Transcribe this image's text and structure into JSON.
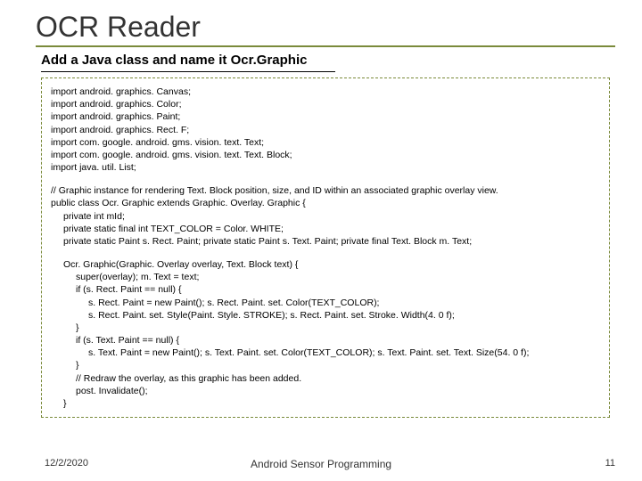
{
  "title": "OCR Reader",
  "subtitle": "Add a Java class and name it Ocr.Graphic",
  "imports": [
    "import android. graphics. Canvas;",
    "import android. graphics. Color;",
    "import android. graphics. Paint;",
    "import android. graphics. Rect. F;",
    "import com. google. android. gms. vision. text. Text;",
    "import com. google. android. gms. vision. text. Text. Block;",
    "import java. util. List;"
  ],
  "comment": "// Graphic instance for rendering Text. Block position, size, and ID within an associated graphic overlay view.",
  "classdecl": "public class Ocr. Graphic extends Graphic. Overlay. Graphic {",
  "fields": [
    "private int mId;",
    "private static final int TEXT_COLOR = Color. WHITE;",
    "private static Paint s. Rect. Paint;  private static Paint s. Text. Paint;  private final Text. Block m. Text;"
  ],
  "ctor": {
    "sig": "Ocr. Graphic(Graphic. Overlay overlay, Text. Block text) {",
    "l1": "super(overlay);  m. Text = text;",
    "l2": "if (s. Rect. Paint == null) {",
    "l3": "s. Rect. Paint = new Paint();   s. Rect. Paint. set. Color(TEXT_COLOR);",
    "l4": "s. Rect. Paint. set. Style(Paint. Style. STROKE);   s. Rect. Paint. set. Stroke. Width(4. 0 f);",
    "l5": "}",
    "l6": "if (s. Text. Paint == null) {",
    "l7": "s. Text. Paint = new Paint();  s. Text. Paint. set. Color(TEXT_COLOR);   s. Text. Paint. set. Text. Size(54. 0 f);",
    "l8": "}",
    "l9": "// Redraw the overlay, as this graphic has been added.",
    "l10": "post. Invalidate();",
    "close": "}"
  },
  "footer": {
    "date": "12/2/2020",
    "center": "Android Sensor Programming",
    "page": "11"
  }
}
